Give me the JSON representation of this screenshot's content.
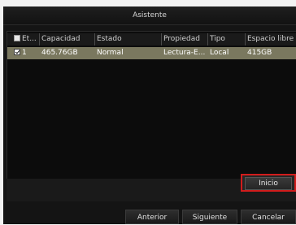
{
  "window": {
    "title": "Asistente"
  },
  "table": {
    "columns": [
      "Et...",
      "Capacidad",
      "Estado",
      "Propiedad",
      "Tipo",
      "Espacio libre"
    ],
    "rows": [
      {
        "checked": true,
        "label": "1",
        "capacity": "465.76GB",
        "status": "Normal",
        "property": "Lectura-E...",
        "type": "Local",
        "free_space": "415GB"
      }
    ]
  },
  "actions": {
    "start_label": "Inicio",
    "prev_label": "Anterior",
    "next_label": "Siguiente",
    "cancel_label": "Cancelar"
  },
  "colors": {
    "selected_row": "#7a785f",
    "highlight_border": "#d11c1c",
    "background": "#141414"
  }
}
